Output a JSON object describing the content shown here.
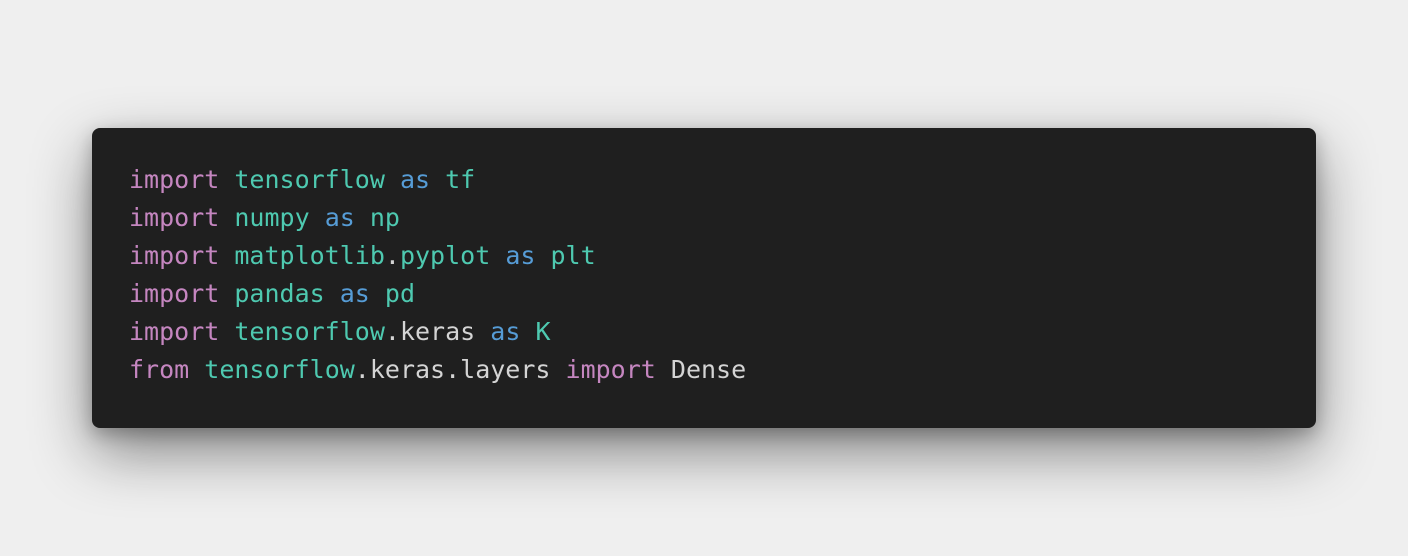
{
  "code_card": {
    "lines": [
      {
        "tokens": [
          {
            "text": "import",
            "kind": "keyword"
          },
          {
            "text": " ",
            "kind": "plain"
          },
          {
            "text": "tensorflow",
            "kind": "module"
          },
          {
            "text": " ",
            "kind": "plain"
          },
          {
            "text": "as",
            "kind": "alias"
          },
          {
            "text": " ",
            "kind": "plain"
          },
          {
            "text": "tf",
            "kind": "module"
          }
        ]
      },
      {
        "tokens": [
          {
            "text": "import",
            "kind": "keyword"
          },
          {
            "text": " ",
            "kind": "plain"
          },
          {
            "text": "numpy",
            "kind": "module"
          },
          {
            "text": " ",
            "kind": "plain"
          },
          {
            "text": "as",
            "kind": "alias"
          },
          {
            "text": " ",
            "kind": "plain"
          },
          {
            "text": "np",
            "kind": "module"
          }
        ]
      },
      {
        "tokens": [
          {
            "text": "import",
            "kind": "keyword"
          },
          {
            "text": " ",
            "kind": "plain"
          },
          {
            "text": "matplotlib",
            "kind": "module"
          },
          {
            "text": ".",
            "kind": "plain"
          },
          {
            "text": "pyplot",
            "kind": "module"
          },
          {
            "text": " ",
            "kind": "plain"
          },
          {
            "text": "as",
            "kind": "alias"
          },
          {
            "text": " ",
            "kind": "plain"
          },
          {
            "text": "plt",
            "kind": "module"
          }
        ]
      },
      {
        "tokens": [
          {
            "text": "import",
            "kind": "keyword"
          },
          {
            "text": " ",
            "kind": "plain"
          },
          {
            "text": "pandas",
            "kind": "module"
          },
          {
            "text": " ",
            "kind": "plain"
          },
          {
            "text": "as",
            "kind": "alias"
          },
          {
            "text": " ",
            "kind": "plain"
          },
          {
            "text": "pd",
            "kind": "module"
          }
        ]
      },
      {
        "tokens": [
          {
            "text": "import",
            "kind": "keyword"
          },
          {
            "text": " ",
            "kind": "plain"
          },
          {
            "text": "tensorflow",
            "kind": "module"
          },
          {
            "text": ".keras",
            "kind": "plain"
          },
          {
            "text": " ",
            "kind": "plain"
          },
          {
            "text": "as",
            "kind": "alias"
          },
          {
            "text": " ",
            "kind": "plain"
          },
          {
            "text": "K",
            "kind": "module"
          }
        ]
      },
      {
        "tokens": [
          {
            "text": "from",
            "kind": "keyword"
          },
          {
            "text": " ",
            "kind": "plain"
          },
          {
            "text": "tensorflow",
            "kind": "module"
          },
          {
            "text": ".keras.layers",
            "kind": "plain"
          },
          {
            "text": " ",
            "kind": "plain"
          },
          {
            "text": "import",
            "kind": "keyword"
          },
          {
            "text": " ",
            "kind": "plain"
          },
          {
            "text": "Dense",
            "kind": "plain"
          }
        ]
      }
    ]
  },
  "colors": {
    "page_background": "#efefef",
    "card_background": "#1f1f1f",
    "keyword": "#c586c0",
    "module": "#4ec9b0",
    "alias": "#569cd6",
    "plain": "#d4d4d4"
  }
}
